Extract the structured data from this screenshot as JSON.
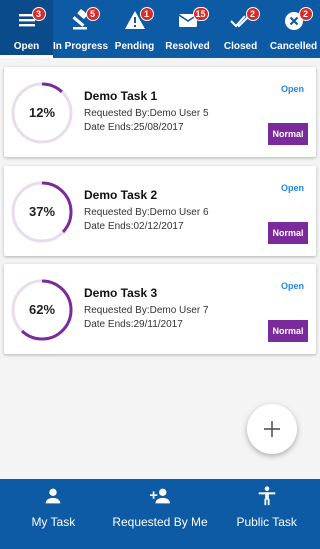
{
  "colors": {
    "primary": "#0d5aa5",
    "badge": "#d92a2a",
    "progress": "#7b2a9b",
    "progress_track": "#e8dcef",
    "status_text": "#1e88e5",
    "priority_bg": "#7b2a9b"
  },
  "tabs": [
    {
      "label": "Open",
      "badge": "3",
      "icon": "list-icon",
      "active": true
    },
    {
      "label": "In Progress",
      "badge": "5",
      "icon": "gavel-icon",
      "active": false
    },
    {
      "label": "Pending",
      "badge": "1",
      "icon": "warning-icon",
      "active": false
    },
    {
      "label": "Resolved",
      "badge": "15",
      "icon": "mail-icon",
      "active": false
    },
    {
      "label": "Closed",
      "badge": "2",
      "icon": "double-check-icon",
      "active": false
    },
    {
      "label": "Cancelled",
      "badge": "2",
      "icon": "cancel-icon",
      "active": false
    }
  ],
  "tasks": [
    {
      "progress_label": "12%",
      "progress_value": 12,
      "title": "Demo Task 1",
      "requested_by": "Requested By:Demo User 5",
      "date_ends": "Date Ends:25/08/2017",
      "status": "Open",
      "priority": "Normal"
    },
    {
      "progress_label": "37%",
      "progress_value": 37,
      "title": "Demo Task 2",
      "requested_by": "Requested By:Demo User 6",
      "date_ends": "Date Ends:02/12/2017",
      "status": "Open",
      "priority": "Normal"
    },
    {
      "progress_label": "62%",
      "progress_value": 62,
      "title": "Demo Task 3",
      "requested_by": "Requested By:Demo User 7",
      "date_ends": "Date Ends:29/11/2017",
      "status": "Open",
      "priority": "Normal"
    }
  ],
  "fab": {
    "icon": "plus-icon"
  },
  "bottom_nav": [
    {
      "label": "My Task",
      "icon": "person-icon"
    },
    {
      "label": "Requested By Me",
      "icon": "person-add-icon"
    },
    {
      "label": "Public Task",
      "icon": "accessibility-icon"
    }
  ]
}
